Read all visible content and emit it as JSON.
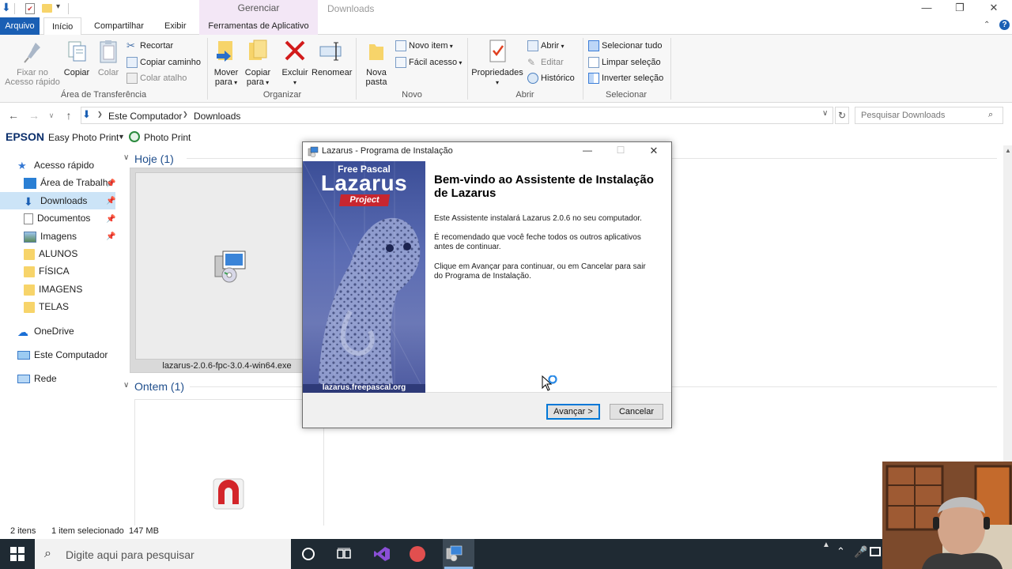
{
  "titlebar": {
    "manage_tab": "Gerenciar",
    "title": "Downloads"
  },
  "ribbon_tabs": {
    "arquivo": "Arquivo",
    "inicio": "Início",
    "compartilhar": "Compartilhar",
    "exibir": "Exibir",
    "ferramentas": "Ferramentas de Aplicativo"
  },
  "ribbon": {
    "pin_quick_access": [
      "Fixar no",
      "Acesso rápido"
    ],
    "copy": "Copiar",
    "paste": "Colar",
    "cut": "Recortar",
    "copy_path": "Copiar caminho",
    "paste_shortcut": "Colar atalho",
    "group_clipboard": "Área de Transferência",
    "move_to": [
      "Mover",
      "para"
    ],
    "copy_to": [
      "Copiar",
      "para"
    ],
    "delete": "Excluir",
    "rename": "Renomear",
    "group_organize": "Organizar",
    "new_folder": [
      "Nova",
      "pasta"
    ],
    "new_item": "Novo item",
    "easy_access": "Fácil acesso",
    "group_new": "Novo",
    "properties": "Propriedades",
    "open": "Abrir",
    "edit": "Editar",
    "history": "Histórico",
    "group_open": "Abrir",
    "select_all": "Selecionar tudo",
    "select_none": "Limpar seleção",
    "invert_selection": "Inverter seleção",
    "group_select": "Selecionar"
  },
  "address": {
    "crumb1": "Este Computador",
    "crumb2": "Downloads",
    "search_placeholder": "Pesquisar Downloads"
  },
  "epson": {
    "brand": "EPSON",
    "app": "Easy Photo Print",
    "photo_print": "Photo Print"
  },
  "nav": {
    "quick_access": "Acesso rápido",
    "desktop": "Área de Trabalho",
    "downloads": "Downloads",
    "documents": "Documentos",
    "images": "Imagens",
    "alunos": "ALUNOS",
    "fisica": "FÍSICA",
    "imagens": "IMAGENS",
    "telas": "TELAS",
    "onedrive": "OneDrive",
    "this_pc": "Este Computador",
    "network": "Rede"
  },
  "content": {
    "today": "Hoje (1)",
    "yesterday": "Ontem (1)",
    "file1": "lazarus-2.0.6-fpc-3.0.4-win64.exe"
  },
  "dialog": {
    "title": "Lazarus - Programa de Instalação",
    "banner_top": "Free Pascal",
    "banner_name": "Lazarus",
    "banner_project": "Project",
    "banner_url": "lazarus.freepascal.org",
    "heading": "Bem-vindo ao Assistente de Instalação de Lazarus",
    "p1": "Este Assistente instalará Lazarus 2.0.6 no seu computador.",
    "p2": "É recomendado que você feche todos os outros aplicativos antes de continuar.",
    "p3": "Clique em Avançar para continuar, ou em Cancelar para sair do Programa de Instalação.",
    "next": "Avançar >",
    "cancel": "Cancelar"
  },
  "status": {
    "items": "2 itens",
    "selected": "1 item selecionado",
    "size": "147 MB"
  },
  "taskbar": {
    "search_placeholder": "Digite aqui para pesquisar"
  },
  "colors": {
    "accent": "#1a5fb4",
    "manage_tab": "#f3e7f6",
    "taskbar": "#1f2a33"
  }
}
